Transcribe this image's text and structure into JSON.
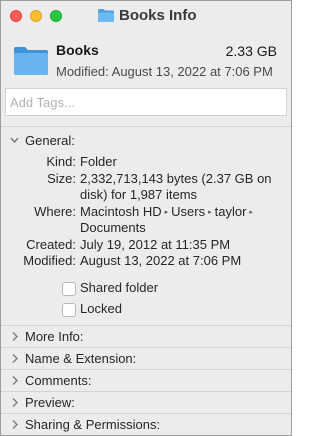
{
  "window": {
    "title": "Books Info",
    "title_icon": "folder-icon"
  },
  "header": {
    "name": "Books",
    "size": "2.33 GB",
    "modified": "Modified:  August 13, 2022 at 7:06 PM",
    "icon": "folder-icon"
  },
  "tags": {
    "placeholder": "Add Tags...",
    "value": ""
  },
  "general": {
    "section_label": "General:",
    "expanded": true,
    "kind_label": "Kind:",
    "kind_value": "Folder",
    "size_label": "Size:",
    "size_value_line1": "2,332,713,143 bytes (2.37 GB on",
    "size_value_line2": "disk) for 1,987 items",
    "where_label": "Where:",
    "where_path": [
      "Macintosh HD",
      "Users",
      "taylor"
    ],
    "where_line2": "Documents",
    "created_label": "Created:",
    "created_value": "July 19, 2012 at 11:35 PM",
    "modified_label": "Modified:",
    "modified_value": "August 13, 2022 at 7:06 PM",
    "shared_folder_label": "Shared folder",
    "shared_folder_checked": false,
    "locked_label": "Locked",
    "locked_checked": false
  },
  "sections": [
    {
      "label": "More Info:",
      "expanded": false
    },
    {
      "label": "Name & Extension:",
      "expanded": false
    },
    {
      "label": "Comments:",
      "expanded": false
    },
    {
      "label": "Preview:",
      "expanded": false
    },
    {
      "label": "Sharing & Permissions:",
      "expanded": false
    }
  ],
  "colors": {
    "folder_blue": "#5aaee9",
    "window_bg": "#ececec",
    "close": "#fe5f57",
    "minimize": "#febc2e",
    "zoom": "#28c840"
  }
}
